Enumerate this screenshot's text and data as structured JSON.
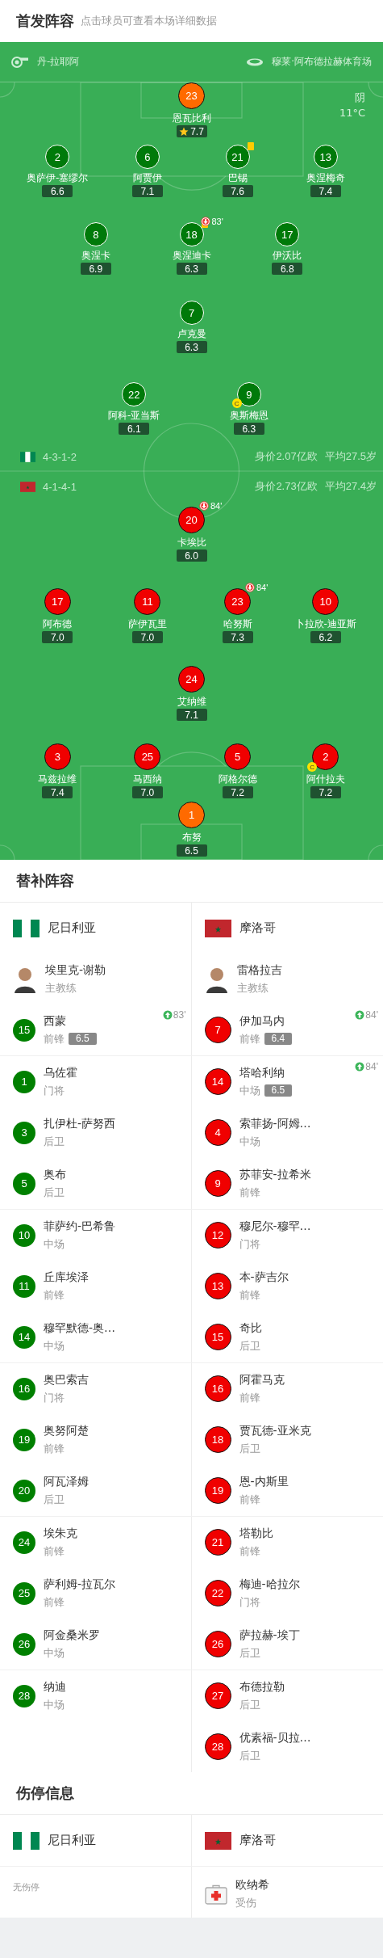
{
  "lineup": {
    "title": "首发阵容",
    "hint": "点击球员可查看本场详细数据"
  },
  "pitch": {
    "referee": "丹-拉耶阿",
    "stadium": "穆莱·阿布德拉赫体育场",
    "weather": "阴",
    "temperature": "11°C",
    "teams": [
      {
        "kind": "home",
        "formation": "4-3-1-2",
        "value": "身价2.07亿欧",
        "avg_age": "平均27.5岁",
        "lines": [
          [
            {
              "number": "23",
              "name": "恩瓦比利",
              "rating": "7.7",
              "kind": "goalkeeper",
              "best": true,
              "yellow": false
            }
          ],
          [
            {
              "number": "2",
              "name": "奥萨伊-塞缪尔",
              "rating": "6.6",
              "kind": "outfield",
              "best": false,
              "yellow": false
            },
            {
              "number": "6",
              "name": "阿贾伊",
              "rating": "7.1",
              "kind": "outfield",
              "best": false,
              "yellow": false
            },
            {
              "number": "21",
              "name": "巴锡",
              "rating": "7.6",
              "kind": "outfield",
              "best": false,
              "yellow": true
            },
            {
              "number": "13",
              "name": "奥涅梅奇",
              "rating": "7.4",
              "kind": "outfield",
              "best": false,
              "yellow": false
            }
          ],
          [
            {
              "number": "8",
              "name": "奥涅卡",
              "rating": "6.9",
              "kind": "outfield",
              "best": false,
              "yellow": false
            },
            {
              "number": "18",
              "name": "奥涅迪卡",
              "rating": "6.3",
              "kind": "outfield",
              "best": false,
              "yellow": true,
              "sub_out": "83'"
            },
            {
              "number": "17",
              "name": "伊沃比",
              "rating": "6.8",
              "kind": "outfield",
              "best": false,
              "yellow": false
            }
          ],
          [
            {
              "number": "7",
              "name": "卢克曼",
              "rating": "6.3",
              "kind": "outfield",
              "best": false,
              "yellow": false
            }
          ],
          [
            {
              "number": "22",
              "name": "阿科-亚当斯",
              "rating": "6.1",
              "kind": "outfield",
              "best": false,
              "yellow": false
            },
            {
              "number": "9",
              "name": "奥斯梅恩",
              "rating": "6.3",
              "kind": "outfield",
              "best": false,
              "yellow": false,
              "captain": "C"
            }
          ]
        ]
      },
      {
        "kind": "away",
        "formation": "4-1-4-1",
        "value": "身价2.73亿欧",
        "avg_age": "平均27.4岁",
        "lines": [
          [
            {
              "number": "20",
              "name": "卡埃比",
              "rating": "6.0",
              "kind": "outfield",
              "best": false,
              "yellow": false,
              "sub_out": "84'"
            }
          ],
          [
            {
              "number": "17",
              "name": "阿布德",
              "rating": "7.0",
              "kind": "outfield",
              "best": false,
              "yellow": false
            },
            {
              "number": "11",
              "name": "萨伊瓦里",
              "rating": "7.0",
              "kind": "outfield",
              "best": false,
              "yellow": false
            },
            {
              "number": "23",
              "name": "哈努斯",
              "rating": "7.3",
              "kind": "outfield",
              "best": false,
              "yellow": false,
              "sub_out": "84'"
            },
            {
              "number": "10",
              "name": "卜拉欣-迪亚斯",
              "rating": "6.2",
              "kind": "outfield",
              "best": false,
              "yellow": false
            }
          ],
          [
            {
              "number": "24",
              "name": "艾纳维",
              "rating": "7.1",
              "kind": "outfield",
              "best": false,
              "yellow": false
            }
          ],
          [
            {
              "number": "3",
              "name": "马兹拉维",
              "rating": "7.4",
              "kind": "outfield",
              "best": false,
              "yellow": false
            },
            {
              "number": "25",
              "name": "马西纳",
              "rating": "7.0",
              "kind": "outfield",
              "best": false,
              "yellow": false
            },
            {
              "number": "5",
              "name": "阿格尔德",
              "rating": "7.2",
              "kind": "outfield",
              "best": false,
              "yellow": false
            },
            {
              "number": "2",
              "name": "阿什拉夫",
              "rating": "7.2",
              "kind": "outfield",
              "best": false,
              "yellow": false,
              "captain": "C"
            }
          ],
          [
            {
              "number": "1",
              "name": "布努",
              "rating": "6.5",
              "kind": "goalkeeper",
              "best": false,
              "yellow": false
            }
          ]
        ]
      }
    ]
  },
  "substitutes": {
    "title": "替补阵容",
    "teams": [
      {
        "kind": "home",
        "name": "尼日利亚",
        "coach": {
          "name": "埃里克-谢勒",
          "role": "主教练"
        },
        "players": [
          {
            "number": "15",
            "name": "西蒙",
            "position": "前锋",
            "rating": "6.5",
            "sub_in": "83'"
          },
          {
            "number": "1",
            "name": "乌佐霍",
            "position": "门将"
          },
          {
            "number": "3",
            "name": "扎伊杜-萨努西",
            "position": "后卫"
          },
          {
            "number": "5",
            "name": "奥布",
            "position": "后卫"
          },
          {
            "number": "10",
            "name": "菲萨约-巴希鲁",
            "position": "中场"
          },
          {
            "number": "11",
            "name": "丘库埃泽",
            "position": "前锋"
          },
          {
            "number": "14",
            "name": "穆罕默德-奥…",
            "position": "中场"
          },
          {
            "number": "16",
            "name": "奥巴索吉",
            "position": "门将"
          },
          {
            "number": "19",
            "name": "奥努阿楚",
            "position": "前锋"
          },
          {
            "number": "20",
            "name": "阿瓦泽姆",
            "position": "后卫"
          },
          {
            "number": "24",
            "name": "埃朱克",
            "position": "前锋"
          },
          {
            "number": "25",
            "name": "萨利姆-拉瓦尔",
            "position": "前锋"
          },
          {
            "number": "26",
            "name": "阿金桑米罗",
            "position": "中场"
          },
          {
            "number": "28",
            "name": "纳迪",
            "position": "中场"
          }
        ]
      },
      {
        "kind": "away",
        "name": "摩洛哥",
        "coach": {
          "name": "雷格拉吉",
          "role": "主教练"
        },
        "players": [
          {
            "number": "7",
            "name": "伊加马内",
            "position": "前锋",
            "rating": "6.4",
            "sub_in": "84'"
          },
          {
            "number": "14",
            "name": "塔哈利纳",
            "position": "中场",
            "rating": "6.5",
            "sub_in": "84'"
          },
          {
            "number": "4",
            "name": "索菲扬-阿姆…",
            "position": "中场"
          },
          {
            "number": "9",
            "name": "苏菲安-拉希米",
            "position": "前锋"
          },
          {
            "number": "12",
            "name": "穆尼尔-穆罕…",
            "position": "门将"
          },
          {
            "number": "13",
            "name": "本-萨吉尔",
            "position": "前锋"
          },
          {
            "number": "15",
            "name": "奇比",
            "position": "后卫"
          },
          {
            "number": "16",
            "name": "阿霍马克",
            "position": "前锋"
          },
          {
            "number": "18",
            "name": "贾瓦德-亚米克",
            "position": "后卫"
          },
          {
            "number": "19",
            "name": "恩-内斯里",
            "position": "前锋"
          },
          {
            "number": "21",
            "name": "塔勒比",
            "position": "前锋"
          },
          {
            "number": "22",
            "name": "梅迪-哈拉尔",
            "position": "门将"
          },
          {
            "number": "26",
            "name": "萨拉赫-埃丁",
            "position": "后卫"
          },
          {
            "number": "27",
            "name": "布德拉勒",
            "position": "后卫"
          },
          {
            "number": "28",
            "name": "优素福-贝拉…",
            "position": "后卫"
          }
        ]
      }
    ]
  },
  "injuries": {
    "title": "伤停信息",
    "teams": [
      {
        "kind": "home",
        "name": "尼日利亚",
        "note": "无伤停"
      },
      {
        "kind": "away",
        "name": "摩洛哥",
        "players": [
          {
            "name": "欧纳希",
            "status": "受伤"
          }
        ]
      }
    ]
  }
}
